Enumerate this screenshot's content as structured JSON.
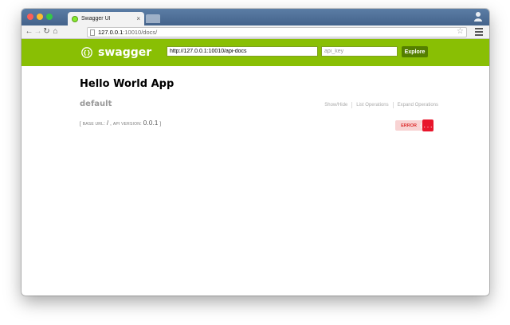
{
  "browser": {
    "tab_title": "Swagger UI",
    "tab_close": "×",
    "url_host": "127.0.0.1",
    "url_path": ":10010/docs/"
  },
  "header": {
    "logo_text": "swagger",
    "api_url": "http://127.0.0.1:10010/api-docs",
    "api_key_placeholder": "api_key",
    "explore_label": "Explore",
    "brand_color": "#89bf04"
  },
  "main": {
    "app_title": "Hello World App",
    "resource": {
      "name": "default",
      "operations": [
        "Show/Hide",
        "List Operations",
        "Expand Operations"
      ]
    },
    "base_info": {
      "base_url_label": "Base url",
      "base_url_value": "/",
      "api_version_label": "Api version",
      "api_version_value": "0.0.1"
    },
    "validator": {
      "label": "ERROR",
      "badge": "{...}"
    }
  }
}
